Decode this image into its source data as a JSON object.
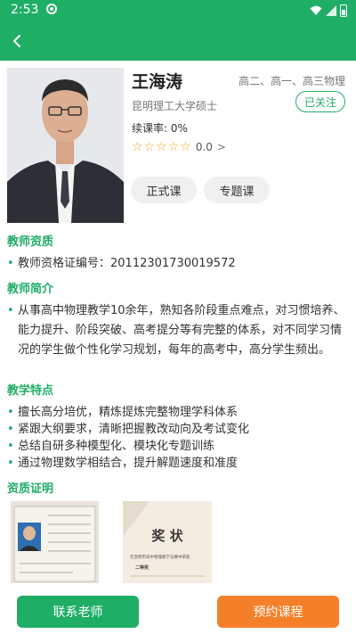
{
  "status_bar": {
    "time": "2:53"
  },
  "teacher": {
    "name": "王海涛",
    "subjects": "高二、高一、高三物理",
    "school": "昆明理工大学硕士",
    "follow_label": "已关注",
    "renewal_rate": "续课率: 0%",
    "rating_value": "0.0",
    "rating_stars": 0,
    "rating_max": 5
  },
  "course_tabs": [
    "正式课",
    "专题课"
  ],
  "qualification": {
    "title": "教师资质",
    "items": [
      "教师资格证编号：20112301730019572"
    ]
  },
  "intro": {
    "title": "教师简介",
    "text": "从事高中物理教学10余年，熟知各阶段重点难点，对习惯培养、能力提升、阶段突破、高考提分等有完整的体系，对不同学习情况的学生做个性化学习规划，每年的高考中，高分学生频出。"
  },
  "features": {
    "title": "教学特点",
    "items": [
      "擅长高分培优，精炼提炼完整物理学科体系",
      "紧跟大纲要求，清晰把握教改动向及考试变化",
      "总结自研多种模型化、模块化专题训练",
      "通过物理数学相结合，提升解题速度和准度"
    ]
  },
  "certificates": {
    "title": "资质证明",
    "award_text": "奖  状",
    "award_line": "在昆明市高中物理教学竞赛中荣获",
    "award_rank": "二等奖"
  },
  "actions": {
    "contact": "联系老师",
    "book": "预约课程"
  },
  "colors": {
    "brand_green": "#1fae66",
    "accent_orange": "#f5802a",
    "star": "#f5a623"
  }
}
